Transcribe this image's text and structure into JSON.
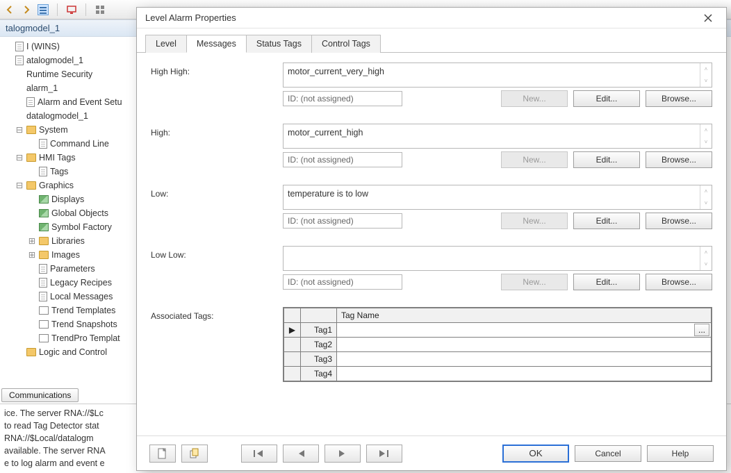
{
  "toolbar_icons": [
    "back",
    "forward",
    "list",
    "monitor",
    "divider",
    "grid"
  ],
  "tree_title": "talogmodel_1",
  "tree": [
    {
      "ind": "ind1",
      "icon": "file",
      "label": "I (WINS)"
    },
    {
      "ind": "ind1",
      "icon": "file",
      "label": "atalogmodel_1"
    },
    {
      "ind": "ind2",
      "icon": "none",
      "label": "Runtime Security"
    },
    {
      "ind": "ind2",
      "icon": "none",
      "label": "alarm_1"
    },
    {
      "ind": "ind2",
      "icon": "file",
      "label": "Alarm and Event Setu"
    },
    {
      "ind": "ind2",
      "icon": "none",
      "label": "datalogmodel_1"
    },
    {
      "ind": "ind2",
      "icon": "folder",
      "label": "System",
      "tw": "-"
    },
    {
      "ind": "ind3",
      "icon": "file",
      "label": "Command Line"
    },
    {
      "ind": "ind2",
      "icon": "folder",
      "label": "HMI Tags",
      "tw": "-"
    },
    {
      "ind": "ind3",
      "icon": "file",
      "label": "Tags"
    },
    {
      "ind": "ind2",
      "icon": "folder",
      "label": "Graphics",
      "tw": "-"
    },
    {
      "ind": "ind3",
      "icon": "img",
      "label": "Displays"
    },
    {
      "ind": "ind3",
      "icon": "img",
      "label": "Global Objects"
    },
    {
      "ind": "ind3",
      "icon": "img",
      "label": "Symbol Factory"
    },
    {
      "ind": "ind3",
      "icon": "folder",
      "label": "Libraries",
      "tw": "+"
    },
    {
      "ind": "ind3",
      "icon": "folder",
      "label": "Images",
      "tw": "+"
    },
    {
      "ind": "ind3",
      "icon": "file",
      "label": "Parameters"
    },
    {
      "ind": "ind3",
      "icon": "file",
      "label": "Legacy Recipes"
    },
    {
      "ind": "ind3",
      "icon": "file",
      "label": "Local Messages"
    },
    {
      "ind": "ind3",
      "icon": "chart",
      "label": "Trend Templates"
    },
    {
      "ind": "ind3",
      "icon": "chart",
      "label": "Trend Snapshots"
    },
    {
      "ind": "ind3",
      "icon": "chart",
      "label": "TrendPro Templat"
    },
    {
      "ind": "ind2",
      "icon": "folder",
      "label": "Logic and Control"
    }
  ],
  "bg_tab_button": "Communications",
  "footer_lines": [
    "ice. The server RNA://$Lc",
    "to read Tag Detector stat",
    "RNA://$Local/datalogm",
    "available. The server RNA",
    "e to log alarm and event e"
  ],
  "dialog": {
    "title": "Level Alarm Properties",
    "tabs": [
      "Level",
      "Messages",
      "Status Tags",
      "Control Tags"
    ],
    "active_tab": 1,
    "id_placeholder": "ID: (not assigned)",
    "buttons": {
      "new": "New...",
      "edit": "Edit...",
      "browse": "Browse..."
    },
    "fields": [
      {
        "label": "High High:",
        "value": "motor_current_very_high"
      },
      {
        "label": "High:",
        "value": "motor_current_high"
      },
      {
        "label": "Low:",
        "value": "temperature is to low"
      },
      {
        "label": "Low Low:",
        "value": ""
      }
    ],
    "assoc_label": "Associated Tags:",
    "grid": {
      "header_tagname": "Tag Name",
      "rows": [
        "Tag1",
        "Tag2",
        "Tag3",
        "Tag4"
      ],
      "marker": "▶"
    },
    "footer": {
      "ok": "OK",
      "cancel": "Cancel",
      "help": "Help"
    }
  }
}
